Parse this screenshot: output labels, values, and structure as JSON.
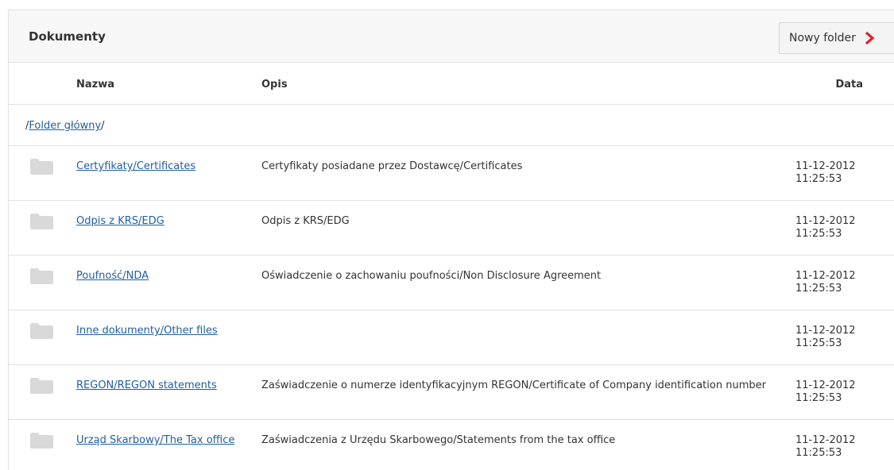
{
  "panel": {
    "title": "Dokumenty",
    "new_folder_label": "Nowy folder"
  },
  "columns": {
    "name": "Nazwa",
    "description": "Opis",
    "date": "Data"
  },
  "breadcrumb": {
    "prefix": "/",
    "link": "Folder główny",
    "suffix": "/"
  },
  "folders": [
    {
      "name": "Certyfikaty/Certificates",
      "description": "Certyfikaty posiadane przez Dostawcę/Certificates",
      "date": "11-12-2012",
      "time": "11:25:53"
    },
    {
      "name": "Odpis z KRS/EDG",
      "description": "Odpis z KRS/EDG",
      "date": "11-12-2012",
      "time": "11:25:53"
    },
    {
      "name": "Poufność/NDA",
      "description": "Oświadczenie o zachowaniu poufności/Non Disclosure Agreement",
      "date": "11-12-2012",
      "time": "11:25:53"
    },
    {
      "name": "Inne dokumenty/Other files",
      "description": "",
      "date": "11-12-2012",
      "time": "11:25:53"
    },
    {
      "name": "REGON/REGON statements",
      "description": "Zaświadczenie o numerze identyfikacyjnym REGON/Certificate of Company identification number",
      "date": "11-12-2012",
      "time": "11:25:53"
    },
    {
      "name": "Urząd Skarbowy/The Tax office",
      "description": "Zaświadczenia z Urzędu Skarbowego/Statements from the tax office",
      "date": "11-12-2012",
      "time": "11:25:53"
    }
  ],
  "colors": {
    "link": "#1f5fa6",
    "accent_chevron": "#d9262c",
    "folder_icon": "#d9d9d9"
  }
}
